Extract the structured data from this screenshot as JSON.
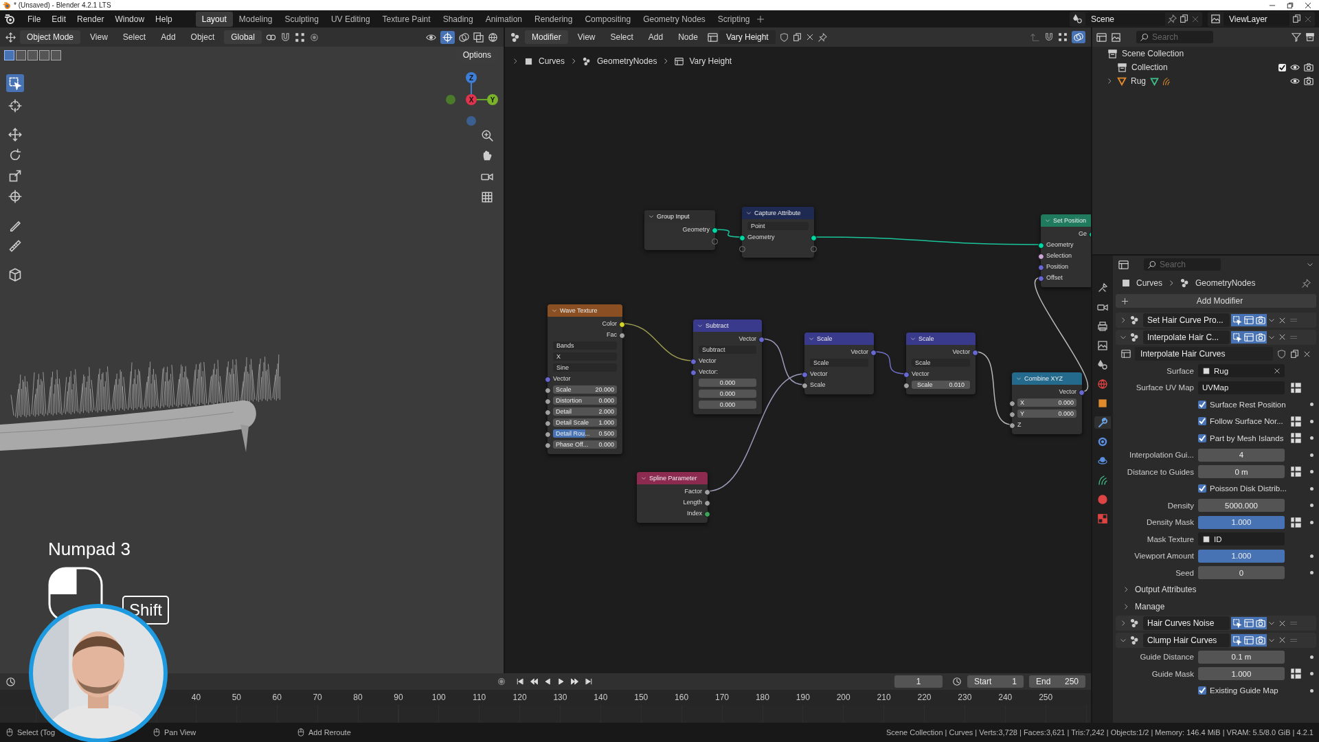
{
  "title_bar": {
    "title": "* (Unsaved) - Blender 4.2.1 LTS"
  },
  "menu": [
    "File",
    "Edit",
    "Render",
    "Window",
    "Help"
  ],
  "workspaces": [
    {
      "label": "Layout",
      "selected": true
    },
    {
      "label": "Modeling",
      "selected": false
    },
    {
      "label": "Sculpting",
      "selected": false
    },
    {
      "label": "UV Editing",
      "selected": false
    },
    {
      "label": "Texture Paint",
      "selected": false
    },
    {
      "label": "Shading",
      "selected": false
    },
    {
      "label": "Animation",
      "selected": false
    },
    {
      "label": "Rendering",
      "selected": false
    },
    {
      "label": "Compositing",
      "selected": false
    },
    {
      "label": "Geometry Nodes",
      "selected": false
    },
    {
      "label": "Scripting",
      "selected": false
    }
  ],
  "scene": {
    "scene": "Scene",
    "view_layer": "ViewLayer"
  },
  "viewport": {
    "mode": "Object Mode",
    "menus": [
      "View",
      "Select",
      "Add",
      "Object"
    ],
    "orientation": "Global",
    "options": "Options",
    "gizmo": {
      "x": "X",
      "y": "Y",
      "z": "Z"
    },
    "keys": {
      "combo": "Numpad 3",
      "modifier": "Shift"
    }
  },
  "node_editor": {
    "context": "Modifier",
    "menus": [
      "View",
      "Select",
      "Add",
      "Node"
    ],
    "group": "Vary Height",
    "breadcrumb": [
      "Curves",
      "GeometryNodes",
      "Vary Height"
    ],
    "nodes": [
      {
        "title": "Group Input",
        "color": "#2e2e2e",
        "rows": [
          {
            "kind": "output",
            "label": "Geometry",
            "socket": {
              "color": "#00d6a3"
            }
          },
          {
            "kind": "virtual_out"
          }
        ]
      },
      {
        "title": "Capture Attribute",
        "color": "#1f2a52",
        "rows": [
          {
            "kind": "dropdown",
            "value": "Point"
          },
          {
            "kind": "through",
            "label": "Geometry",
            "socket": {
              "color": "#00d6a3"
            }
          },
          {
            "kind": "virtual_both"
          }
        ]
      },
      {
        "title": "Set Position",
        "color": "#1f7a5e",
        "rows": [
          {
            "kind": "output",
            "label": "Ge",
            "socket": {
              "color": "#00d6a3"
            }
          },
          {
            "kind": "input",
            "label": "Geometry",
            "socket": {
              "color": "#00d6a3"
            }
          },
          {
            "kind": "input",
            "label": "Selection",
            "socket": {
              "color": "#cca6d6"
            }
          },
          {
            "kind": "input",
            "label": "Position",
            "socket": {
              "color": "#6868d0"
            }
          },
          {
            "kind": "input",
            "label": "Offset",
            "socket": {
              "color": "#6868d0"
            }
          }
        ]
      },
      {
        "title": "Wave Texture",
        "color": "#8a4f22",
        "rows": [
          {
            "kind": "output",
            "label": "Color",
            "socket": {
              "color": "#d6d629"
            }
          },
          {
            "kind": "output",
            "label": "Fac",
            "socket": {
              "color": "#a1a1a1"
            }
          },
          {
            "kind": "dropdown",
            "value": "Bands"
          },
          {
            "kind": "dropdown",
            "value": "X"
          },
          {
            "kind": "dropdown",
            "value": "Sine"
          },
          {
            "kind": "input",
            "label": "Vector",
            "socket": {
              "color": "#6868d0"
            }
          },
          {
            "kind": "field",
            "label": "Scale",
            "value": "20.000",
            "socket": {
              "color": "#a1a1a1"
            }
          },
          {
            "kind": "field",
            "label": "Distortion",
            "value": "0.000",
            "socket": {
              "color": "#a1a1a1"
            }
          },
          {
            "kind": "field",
            "label": "Detail",
            "value": "2.000",
            "socket": {
              "color": "#a1a1a1"
            }
          },
          {
            "kind": "field",
            "label": "Detail Scale",
            "value": "1.000",
            "socket": {
              "color": "#a1a1a1"
            }
          },
          {
            "kind": "field",
            "label": "Detail Rou...",
            "value": "0.500",
            "socket": {
              "color": "#a1a1a1"
            },
            "level": 0.5
          },
          {
            "kind": "field",
            "label": "Phase Off...",
            "value": "0.000",
            "socket": {
              "color": "#a1a1a1"
            }
          }
        ]
      },
      {
        "title": "Subtract",
        "color": "#3a3a8c",
        "rows": [
          {
            "kind": "output",
            "label": "Vector",
            "socket": {
              "color": "#6868d0"
            }
          },
          {
            "kind": "dropdown",
            "value": "Subtract"
          },
          {
            "kind": "input",
            "label": "Vector",
            "socket": {
              "color": "#6868d0"
            }
          },
          {
            "kind": "input",
            "label": "Vector:",
            "socket": {
              "color": "#6868d0"
            }
          },
          {
            "kind": "value",
            "value": "0.000"
          },
          {
            "kind": "value",
            "value": "0.000"
          },
          {
            "kind": "value",
            "value": "0.000"
          }
        ]
      },
      {
        "title": "Scale",
        "color": "#3a3a8c",
        "rows": [
          {
            "kind": "output",
            "label": "Vector",
            "socket": {
              "color": "#6868d0"
            }
          },
          {
            "kind": "dropdown",
            "value": "Scale"
          },
          {
            "kind": "input",
            "label": "Vector",
            "socket": {
              "color": "#6868d0"
            }
          },
          {
            "kind": "input",
            "label": "Scale",
            "socket": {
              "color": "#a1a1a1"
            }
          }
        ]
      },
      {
        "title": "Scale",
        "color": "#3a3a8c",
        "rows": [
          {
            "kind": "output",
            "label": "Vector",
            "socket": {
              "color": "#6868d0"
            }
          },
          {
            "kind": "dropdown",
            "value": "Scale"
          },
          {
            "kind": "input",
            "label": "Vector",
            "socket": {
              "color": "#6868d0"
            }
          },
          {
            "kind": "stepper",
            "label": "Scale",
            "value": "0.010",
            "socket": {
              "color": "#a1a1a1"
            }
          }
        ]
      },
      {
        "title": "Combine XYZ",
        "color": "#246a8c",
        "rows": [
          {
            "kind": "output",
            "label": "Vector",
            "socket": {
              "color": "#6868d0"
            }
          },
          {
            "kind": "field",
            "label": "X",
            "value": "0.000",
            "socket": {
              "color": "#a1a1a1"
            }
          },
          {
            "kind": "field",
            "label": "Y",
            "value": "0.000",
            "socket": {
              "color": "#a1a1a1"
            }
          },
          {
            "kind": "input",
            "label": "Z",
            "socket": {
              "color": "#a1a1a1"
            }
          }
        ]
      },
      {
        "title": "Spline Parameter",
        "color": "#8c2a50",
        "rows": [
          {
            "kind": "output",
            "label": "Factor",
            "socket": {
              "color": "#a1a1a1"
            }
          },
          {
            "kind": "output",
            "label": "Length",
            "socket": {
              "color": "#a1a1a1"
            }
          },
          {
            "kind": "output",
            "label": "Index",
            "socket": {
              "color": "#3fa35a"
            }
          }
        ]
      }
    ]
  },
  "outliner": {
    "search": {
      "placeholder": "Search"
    },
    "items": [
      {
        "label": "Scene Collection",
        "children": [
          {
            "label": "Collection",
            "checked": true
          },
          {
            "label": "Rug",
            "expanded": false
          }
        ]
      }
    ]
  },
  "properties": {
    "search": {
      "placeholder": "Search"
    },
    "breadcrumb": [
      "Curves",
      "GeometryNodes"
    ],
    "add_modifier": "Add Modifier",
    "rows": [
      {
        "kind": "modifier",
        "name": "Set Hair Curve Pro...",
        "expanded": false
      },
      {
        "kind": "modifier",
        "name": "Interpolate Hair C...",
        "expanded": true
      },
      {
        "kind": "group",
        "name": "Interpolate Hair Curves"
      },
      {
        "kind": "object",
        "label": "Surface",
        "value": "Rug",
        "attribute_toggle": false,
        "keyframe": false
      },
      {
        "kind": "text",
        "label": "Surface UV Map",
        "value": "UVMap",
        "attribute_toggle": true,
        "keyframe": false
      },
      {
        "kind": "check",
        "label": "Surface Rest Position",
        "checked": true,
        "attribute_toggle": false,
        "keyframe": true
      },
      {
        "kind": "check",
        "label": "Follow Surface Nor...",
        "checked": true,
        "attribute_toggle": true,
        "keyframe": true
      },
      {
        "kind": "check",
        "label": "Part by Mesh Islands",
        "checked": true,
        "attribute_toggle": true,
        "keyframe": true
      },
      {
        "kind": "number",
        "label": "Interpolation Gui...",
        "value": "4",
        "attribute_toggle": false,
        "keyframe": true
      },
      {
        "kind": "number",
        "label": "Distance to Guides",
        "value": "0 m",
        "attribute_toggle": true,
        "keyframe": true
      },
      {
        "kind": "check",
        "label": "Poisson Disk Distrib...",
        "checked": true,
        "attribute_toggle": false,
        "keyframe": true
      },
      {
        "kind": "number",
        "label": "Density",
        "value": "5000.000",
        "attribute_toggle": false,
        "keyframe": true
      },
      {
        "kind": "slider",
        "label": "Density Mask",
        "value": "1.000",
        "level": 1,
        "attribute_toggle": true,
        "keyframe": true
      },
      {
        "kind": "texture",
        "label": "Mask Texture",
        "placeholder": "ID",
        "attribute_toggle": false,
        "keyframe": false
      },
      {
        "kind": "slider",
        "label": "Viewport Amount",
        "value": "1.000",
        "level": 1,
        "attribute_toggle": false,
        "keyframe": true
      },
      {
        "kind": "number",
        "label": "Seed",
        "value": "0",
        "attribute_toggle": false,
        "keyframe": true
      },
      {
        "kind": "section",
        "label": "Output Attributes",
        "expanded": false
      },
      {
        "kind": "section",
        "label": "Manage",
        "expanded": false
      },
      {
        "kind": "modifier",
        "name": "Hair Curves Noise",
        "expanded": false
      },
      {
        "kind": "modifier",
        "name": "Clump Hair Curves",
        "expanded": true
      },
      {
        "kind": "number",
        "label": "Guide Distance",
        "value": "0.1 m",
        "attribute_toggle": false,
        "keyframe": true
      },
      {
        "kind": "number",
        "label": "Guide Mask",
        "value": "1.000",
        "attribute_toggle": true,
        "keyframe": true
      },
      {
        "kind": "check",
        "label": "Existing Guide Map",
        "checked": true,
        "attribute_toggle": false,
        "keyframe": true
      }
    ]
  },
  "timeline": {
    "current_frame": "1",
    "start_label": "Start",
    "start": "1",
    "end_label": "End",
    "end": "250",
    "ruler": [
      "40",
      "50",
      "60",
      "70",
      "80",
      "90",
      "100",
      "110",
      "120",
      "130",
      "140",
      "150",
      "160",
      "170",
      "180",
      "190",
      "200",
      "210",
      "220",
      "230",
      "240",
      "250"
    ]
  },
  "status_bar": {
    "hints": [
      "Select (Tog",
      "Pan View",
      "Add Reroute"
    ],
    "stats": "Scene Collection | Curves | Verts:3,728 | Faces:3,621 | Tris:7,242 | Objects:1/2 | Memory: 146.4 MiB | VRAM: 5.5/8.0 GiB | 4.2.1"
  }
}
